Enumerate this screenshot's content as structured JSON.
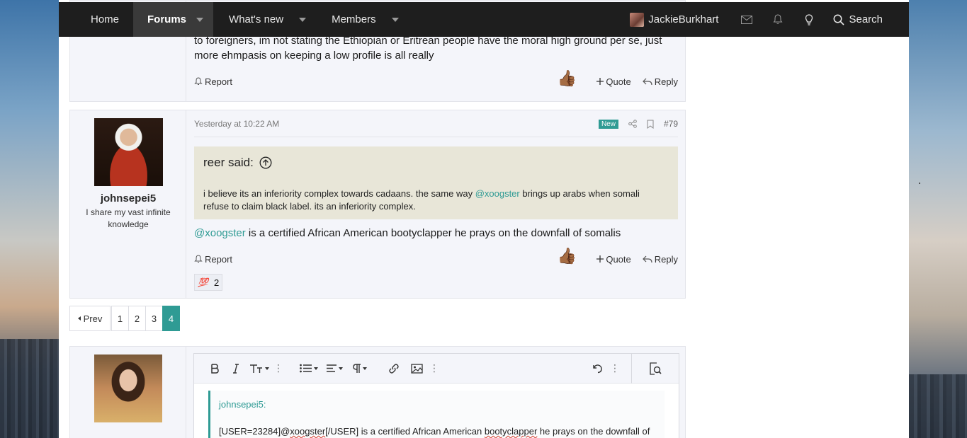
{
  "nav": {
    "home": "Home",
    "forums": "Forums",
    "whats_new": "What's new",
    "members": "Members",
    "username": "JackieBurkhart",
    "search": "Search"
  },
  "post1": {
    "text": "to foreigners, im not stating the Ethiopian or Eritrean people have the moral high ground per se, just more ehmpasis on keeping a low profile is all really",
    "report": "Report",
    "quote": "Quote",
    "reply": "Reply"
  },
  "post2": {
    "username": "johnsepei5",
    "user_title": "I share my vast infinite knowledge",
    "timestamp": "Yesterday at 10:22 AM",
    "badge": "New",
    "post_number": "#79",
    "quote_author": "reer said:",
    "quote_text_1": "i believe its an inferiority complex towards cadaans. the same way ",
    "quote_mention": "@xoogster",
    "quote_text_2": " brings up arabs when somali refuse to claim black label. its an inferiority complex.",
    "reply_mention": "@xoogster",
    "reply_text": " is a certified African American bootyclapper he prays on the downfall of somalis",
    "report": "Report",
    "quote": "Quote",
    "reply": "Reply",
    "reaction_emoji": "💯",
    "reaction_count": "2"
  },
  "pagination": {
    "prev": "Prev",
    "pages": [
      "1",
      "2",
      "3",
      "4"
    ],
    "current": "4"
  },
  "editor": {
    "quote_author": "johnsepei5:",
    "body_1": "[USER=23284]@",
    "body_sp1": "xoogster",
    "body_2": "[/USER] is a certified African American ",
    "body_sp2": "bootyclapper",
    "body_3": " he prays on the downfall of"
  },
  "colors": {
    "accent": "#2f9b94",
    "nav_bg": "#1e1e1e",
    "quote_bg": "#e8e6d8"
  }
}
